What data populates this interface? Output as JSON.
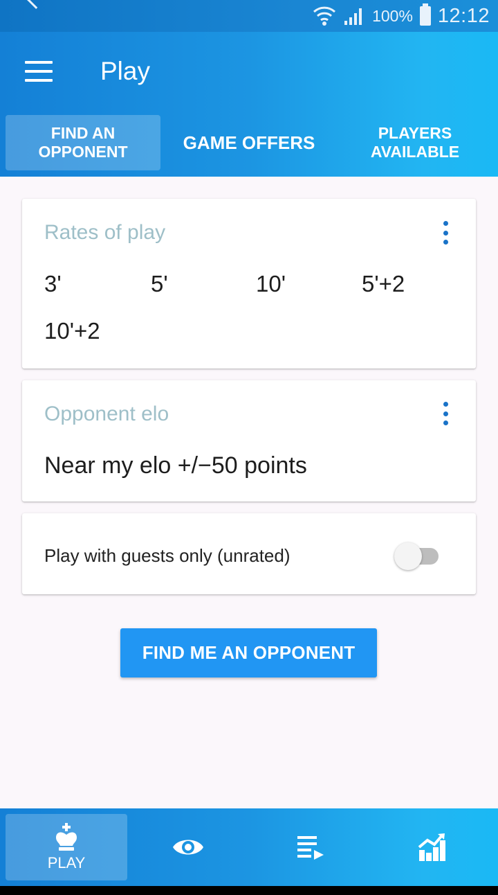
{
  "status_bar": {
    "battery_percent": "100%",
    "time": "12:12",
    "icons": [
      "back-icon",
      "wifi-icon",
      "signal-icon",
      "battery-icon"
    ]
  },
  "app_bar": {
    "title": "Play",
    "menu_icon": "hamburger-menu-icon"
  },
  "tabs": [
    {
      "line1": "FIND AN",
      "line2": "OPPONENT",
      "active": true
    },
    {
      "line1": "GAME OFFERS",
      "line2": "",
      "active": false
    },
    {
      "line1": "PLAYERS",
      "line2": "AVAILABLE",
      "active": false
    }
  ],
  "rates_card": {
    "title": "Rates of play",
    "rates": [
      "3'",
      "5'",
      "10'",
      "5'+2",
      "10'+2"
    ]
  },
  "elo_card": {
    "title": "Opponent elo",
    "value": "Near my elo +/−50 points"
  },
  "guests_card": {
    "label": "Play with guests only (unrated)",
    "toggle_on": false
  },
  "find_button": {
    "label": "FIND ME AN OPPONENT"
  },
  "bottom_nav": [
    {
      "icon": "chess-king-icon",
      "label": "PLAY",
      "active": true
    },
    {
      "icon": "eye-icon",
      "label": "",
      "active": false
    },
    {
      "icon": "playlist-play-icon",
      "label": "",
      "active": false
    },
    {
      "icon": "stats-chart-icon",
      "label": "",
      "active": false
    }
  ],
  "colors": {
    "primary": "#2196f3",
    "card_title": "#9ebfc8",
    "kebab": "#1a73c8"
  }
}
